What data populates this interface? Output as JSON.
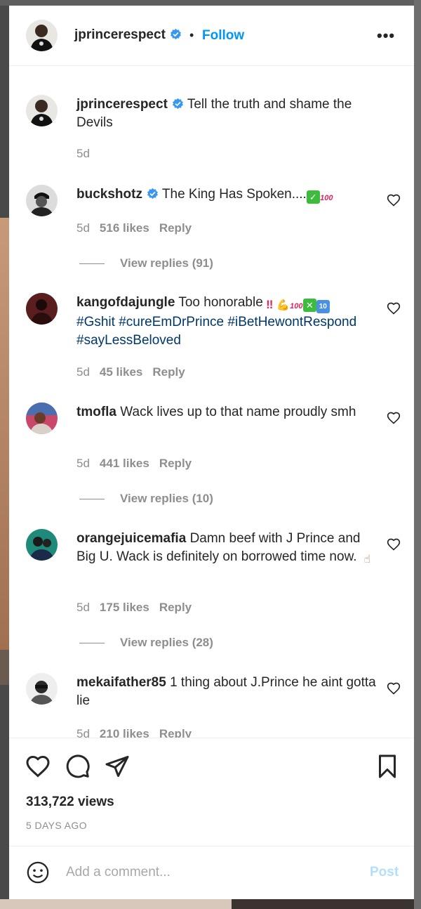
{
  "header": {
    "username": "jprincerespect",
    "separator": "•",
    "follow_label": "Follow",
    "more_label": "•••"
  },
  "caption": {
    "username": "jprincerespect",
    "text": "Tell the truth and shame the Devils",
    "age": "5d"
  },
  "comments": [
    {
      "username": "buckshotz",
      "text": "The King Has Spoken....",
      "age": "5d",
      "likes": "516 likes",
      "reply": "Reply",
      "view_replies": "View replies (91)"
    },
    {
      "username": "kangofdajungle",
      "text": "Too honorable",
      "hashtags": "#Gshit #cureEmDrPrince #iBetHewontRespond #sayLessBeloved",
      "age": "5d",
      "likes": "45 likes",
      "reply": "Reply"
    },
    {
      "username": "tmofla",
      "text": "Wack lives up to that name proudly smh",
      "age": "5d",
      "likes": "441 likes",
      "reply": "Reply",
      "view_replies": "View replies (10)"
    },
    {
      "username": "orangejuicemafia",
      "text": "Damn beef with J Prince and Big U. Wack is definitely on borrowed time now.",
      "age": "5d",
      "likes": "175 likes",
      "reply": "Reply",
      "view_replies": "View replies (28)"
    },
    {
      "username": "mekaifather85",
      "text": "1 thing about J.Prince he aint gotta lie",
      "age": "5d",
      "likes": "210 likes",
      "reply": "Reply"
    }
  ],
  "stats": {
    "views": "313,722 views",
    "posted": "5 DAYS AGO"
  },
  "compose": {
    "placeholder": "Add a comment...",
    "post_label": "Post"
  },
  "colors": {
    "accent": "#0095f6",
    "hashtag": "#00376b",
    "muted": "#8e8e8e",
    "post_disabled": "#b2dffc"
  },
  "icons": {
    "verified": "verified-badge-icon",
    "like": "heart-icon",
    "comment": "comment-bubble-icon",
    "share": "paper-plane-icon",
    "save": "bookmark-icon",
    "emoji": "smiley-icon"
  }
}
